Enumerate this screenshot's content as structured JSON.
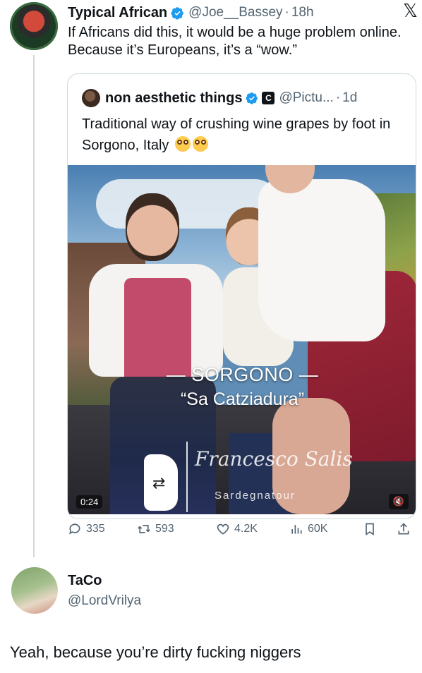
{
  "main_tweet": {
    "author_name": "Typical African",
    "handle": "@Joe__Bassey",
    "dot": "·",
    "time": "18h",
    "text": "If Africans did this, it would be a huge problem online. Because it’s Europeans, it’s a “wow.”"
  },
  "quoted_tweet": {
    "author_name": "non aesthetic things",
    "badge": "C",
    "handle": "@Pictu...",
    "dot": "·",
    "time": "1d",
    "text": "Traditional way of crushing wine grapes by foot in Sorgono, Italy",
    "video": {
      "overlay_line1": "— SORGONO —",
      "overlay_line2": "“Sa Catziadura”",
      "signature": "Francesco Salis",
      "watermark": "Sardegnatour",
      "duration": "0:24"
    }
  },
  "actions": {
    "replies": "335",
    "retweets": "593",
    "likes": "4.2K",
    "views": "60K"
  },
  "reply": {
    "author_name": "TaCo",
    "handle": "@LordVrilya",
    "text": "Yeah, because you’re dirty fucking niggers"
  },
  "icons": {
    "brand_logo": "x-logo",
    "verified": "verified-badge-icon",
    "colors": {
      "verified": "#1d9bf0",
      "secondary_text": "#536471",
      "border": "#cfd9de"
    }
  }
}
